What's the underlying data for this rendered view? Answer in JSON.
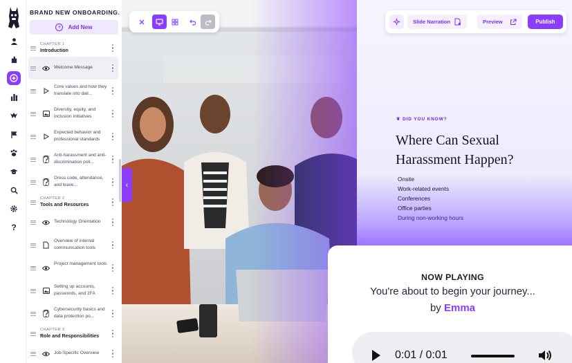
{
  "course_title": "BRAND NEW ONBOARDING...",
  "add_new_label": "Add New",
  "outline": [
    {
      "type": "chapter",
      "label": "CHAPTER 1",
      "name": "Introduction"
    },
    {
      "type": "item",
      "icon": "eye-icon",
      "text": "Welcome Message",
      "selected": true
    },
    {
      "type": "item",
      "icon": "play-icon",
      "text": "Core values and how they translate into dail..."
    },
    {
      "type": "item",
      "icon": "image-icon",
      "text": "Diversity, equity, and inclusion initiatives"
    },
    {
      "type": "item",
      "icon": "play-icon",
      "text": "Expected behavior and professional standards"
    },
    {
      "type": "item",
      "icon": "question-icon",
      "text": "Anti-harassment and anti-discrimination poli..."
    },
    {
      "type": "item",
      "icon": "question-icon",
      "text": "Dress code, attendance, and leave..."
    },
    {
      "type": "chapter",
      "label": "CHAPTER 2",
      "name": "Tools and Resources"
    },
    {
      "type": "item",
      "icon": "eye-icon",
      "text": "Technology Orientation"
    },
    {
      "type": "item",
      "icon": "document-icon",
      "text": "Overview of internal communication tools"
    },
    {
      "type": "item",
      "icon": "eye-icon",
      "text": "Project management tools"
    },
    {
      "type": "item",
      "icon": "image-icon",
      "text": "Setting up accounts, passwords, and 2FA"
    },
    {
      "type": "item",
      "icon": "question-icon",
      "text": "Cybersecurity basics and data protection po..."
    },
    {
      "type": "chapter",
      "label": "CHAPTER 3",
      "name": "Role and Responsibilities"
    },
    {
      "type": "item",
      "icon": "eye-icon",
      "text": "Job-Specific Overview"
    }
  ],
  "rail_icons": [
    "user-icon",
    "puzzle-icon",
    "plus-circle-icon",
    "bar-chart-icon",
    "hands-icon",
    "flag-icon",
    "paw-icon",
    "graduation-cap-icon",
    "search-icon",
    "gear-icon",
    "help-icon"
  ],
  "toolbar": {
    "buttons": [
      "close-icon",
      "desktop-icon",
      "grid-icon",
      "undo-icon",
      "redo-icon"
    ]
  },
  "topbar": {
    "sparkle_icon": "sparkle-icon",
    "narration_label": "Slide Narration",
    "preview_label": "Preview",
    "publish_label": "Publish"
  },
  "slide": {
    "eyebrow": "DID YOU KNOW?",
    "heading": "Where Can Sexual Harassment Happen?",
    "bullets": [
      "Onsite",
      "Work-related events",
      "Conferences",
      "Office parties",
      "During non-working hours"
    ]
  },
  "now_playing": {
    "heading": "NOW PLAYING",
    "message": "You're about to begin your journey...",
    "by_prefix": "by",
    "narrator": "Emma",
    "time": "0:01 / 0:01",
    "progress": 1.0
  },
  "colors": {
    "accent": "#8b3dff",
    "accent_soft": "#efe8ff"
  }
}
